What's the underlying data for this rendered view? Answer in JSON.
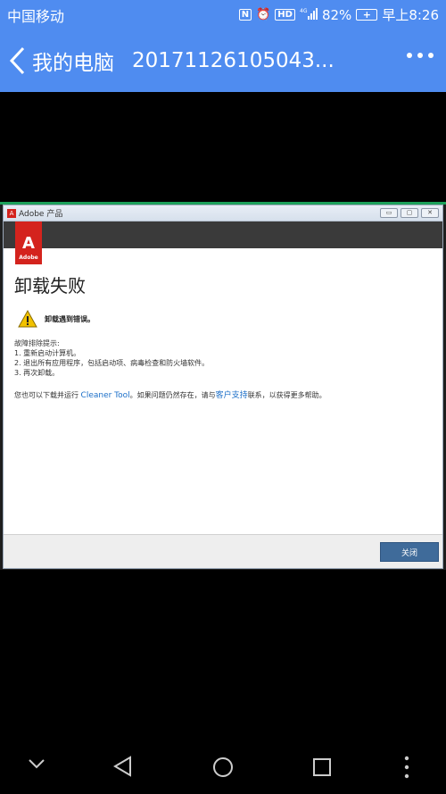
{
  "status_bar": {
    "carrier": "中国移动",
    "nfc": "N",
    "hd": "HD",
    "signal": "4G",
    "battery_percent": "82%",
    "time": "早上8:26"
  },
  "nav": {
    "back_label": "我的电脑",
    "title": "20171126105043..."
  },
  "window": {
    "title": "Adobe 产品",
    "logo_text": "Adobe",
    "controls": [
      "▭",
      "▢",
      "✕"
    ],
    "heading": "卸载失败",
    "warning": "卸载遇到错误。",
    "tips": [
      "故障排除提示:",
      "1. 重新启动计算机。",
      "2. 退出所有应用程序，包括启动项、病毒检查和防火墙软件。",
      "3. 再次卸载。"
    ],
    "footer_prefix": "您也可以下载并运行 ",
    "footer_link1": "Cleaner Tool",
    "footer_middle": "。如果问题仍然存在，请与",
    "footer_link2": "客户支持",
    "footer_suffix": "联系，以获得更多帮助。",
    "close_button": "关闭"
  },
  "accent": "#4f8cf0",
  "adobe_red": "#d4231d"
}
